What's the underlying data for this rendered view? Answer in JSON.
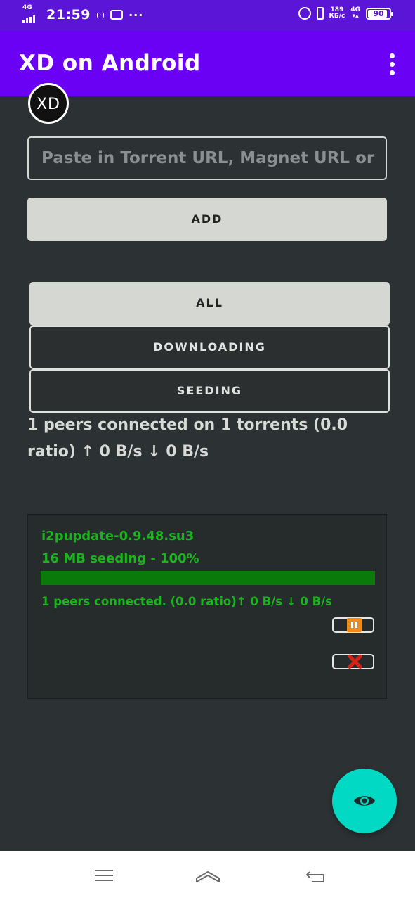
{
  "status_bar": {
    "network": "4G",
    "time": "21:59",
    "speed_value": "189",
    "speed_unit": "КБ/с",
    "network_right": "4G",
    "battery": "90"
  },
  "app_bar": {
    "title": "XD on Android"
  },
  "logo_text": "XD",
  "add_form": {
    "url_placeholder": "Paste in Torrent URL, Magnet URL or",
    "add_label": "ADD"
  },
  "filters": [
    {
      "label": "ALL",
      "active": true
    },
    {
      "label": "DOWNLOADING",
      "active": false
    },
    {
      "label": "SEEDING",
      "active": false
    }
  ],
  "summary": "1 peers connected on 1 torrents (0.0 ratio) ↑ 0 B/s ↓ 0 B/s",
  "torrents": [
    {
      "name": "i2pupdate-0.9.48.su3",
      "status": "16 MB seeding - 100%",
      "progress": 1.0,
      "peers": "1 peers connected. (0.0 ratio)↑ 0 B/s ↓ 0 B/s"
    }
  ],
  "colors": {
    "app_bar": "#6a00f4",
    "status_bar": "#5b15d6",
    "background": "#2c3133",
    "torrent_text": "#19b51d",
    "fab": "#02d9c4"
  },
  "icons": {
    "fab": "eye-icon",
    "pause": "pause-icon",
    "remove": "close-icon",
    "overflow": "more-vert-icon"
  }
}
